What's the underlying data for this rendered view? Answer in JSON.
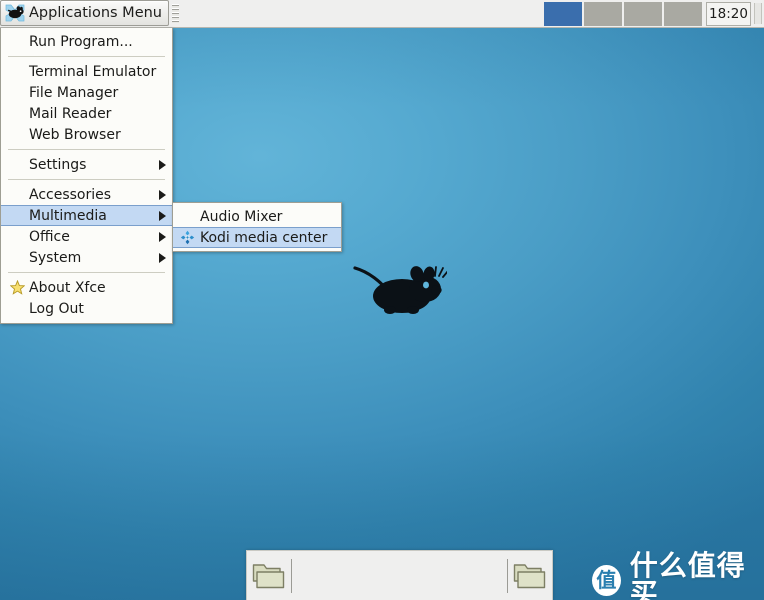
{
  "top_panel": {
    "menu_button": {
      "label": "Applications Menu",
      "icon": "xfce-mouse-logo-icon"
    },
    "handle_icon": "panel-handle-grip-icon",
    "workspaces": [
      {
        "name": "workspace-1",
        "active": true
      },
      {
        "name": "workspace-2",
        "active": false
      },
      {
        "name": "workspace-3",
        "active": false
      },
      {
        "name": "workspace-4",
        "active": false
      }
    ],
    "clock": "18:20"
  },
  "app_menu": {
    "items": [
      {
        "label": "Run Program...",
        "type": "item",
        "icon": null,
        "arrow": false,
        "selected": false
      },
      {
        "type": "separator"
      },
      {
        "label": "Terminal Emulator",
        "type": "item",
        "icon": null,
        "arrow": false,
        "selected": false
      },
      {
        "label": "File Manager",
        "type": "item",
        "icon": null,
        "arrow": false,
        "selected": false
      },
      {
        "label": "Mail Reader",
        "type": "item",
        "icon": null,
        "arrow": false,
        "selected": false
      },
      {
        "label": "Web Browser",
        "type": "item",
        "icon": null,
        "arrow": false,
        "selected": false
      },
      {
        "type": "separator"
      },
      {
        "label": "Settings",
        "type": "item",
        "icon": null,
        "arrow": true,
        "selected": false
      },
      {
        "type": "separator"
      },
      {
        "label": "Accessories",
        "type": "item",
        "icon": null,
        "arrow": true,
        "selected": false
      },
      {
        "label": "Multimedia",
        "type": "item",
        "icon": null,
        "arrow": true,
        "selected": true
      },
      {
        "label": "Office",
        "type": "item",
        "icon": null,
        "arrow": true,
        "selected": false
      },
      {
        "label": "System",
        "type": "item",
        "icon": null,
        "arrow": true,
        "selected": false
      },
      {
        "type": "separator"
      },
      {
        "label": "About Xfce",
        "type": "item",
        "icon": "star-icon",
        "arrow": false,
        "selected": false
      },
      {
        "label": "Log Out",
        "type": "item",
        "icon": null,
        "arrow": false,
        "selected": false
      }
    ]
  },
  "sub_menu": {
    "parent": "Multimedia",
    "items": [
      {
        "label": "Audio Mixer",
        "icon": null,
        "selected": false
      },
      {
        "label": "Kodi media center",
        "icon": "kodi-logo-icon",
        "selected": true
      }
    ]
  },
  "bottom_panel": {
    "items": [
      {
        "name": "file-manager-launcher",
        "icon": "folder-icon"
      },
      {
        "name": "folder-launcher",
        "icon": "folder-icon"
      }
    ]
  },
  "desktop": {
    "logo_icon": "xfce-mouse-logo-icon"
  },
  "watermark": {
    "badge": "值",
    "text": "什么值得买"
  },
  "colors": {
    "accent_blue": "#3a6ead",
    "menu_highlight": "#c3d9f3",
    "panel_bg": "#efefee",
    "desktop_blue": "#3d8fbb",
    "watermark_white": "#ffffff"
  }
}
